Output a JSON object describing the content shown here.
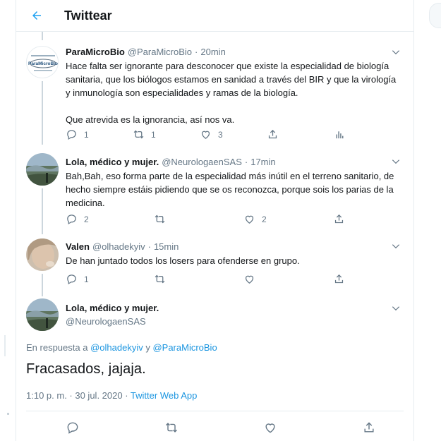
{
  "header": {
    "title": "Twittear"
  },
  "tweets": [
    {
      "name": "ParaMicroBio",
      "handle": "@ParaMicroBio",
      "time": "20min",
      "body": [
        "Hace falta ser ignorante para desconocer que existe la especialidad de biología sanitaria, que los biólogos estamos en sanidad a través del BIR y que la virología y inmunología son especialidades y ramas de la biología.",
        "Que atrevida es la ignorancia, así nos va."
      ],
      "replies": "1",
      "retweets": "1",
      "likes": "3"
    },
    {
      "name": "Lola, médico y mujer.",
      "handle": "@NeurologaenSAS",
      "time": "17min",
      "body": [
        "Bah,Bah, eso forma parte de la especialidad más inútil en el terreno sanitario, de hecho siempre estáis pidiendo que se os reconozca, porque sois los parias de la medicina."
      ],
      "replies": "2",
      "retweets": "",
      "likes": "2"
    },
    {
      "name": "Valen",
      "handle": "@olhadekyiv",
      "time": "15min",
      "body": [
        "De han juntado todos los losers para ofenderse en grupo."
      ],
      "replies": "1",
      "retweets": "",
      "likes": ""
    }
  ],
  "focus": {
    "name": "Lola, médico y mujer.",
    "handle": "@NeurologaenSAS",
    "reply_prefix": "En respuesta a",
    "reply_user1": "@olhadekyiv",
    "reply_and": "y",
    "reply_user2": "@ParaMicroBio",
    "text": "Fracasados, jajaja.",
    "datetime": "1:10 p. m. · 30 jul. 2020 ·",
    "app": "Twitter Web App"
  },
  "sep": "·",
  "avatar_logo_text": "ParaMicroBio",
  "colors": {
    "accent": "#1da1f2",
    "text": "#14171a",
    "muted": "#657786",
    "border": "#e6ecf0"
  }
}
